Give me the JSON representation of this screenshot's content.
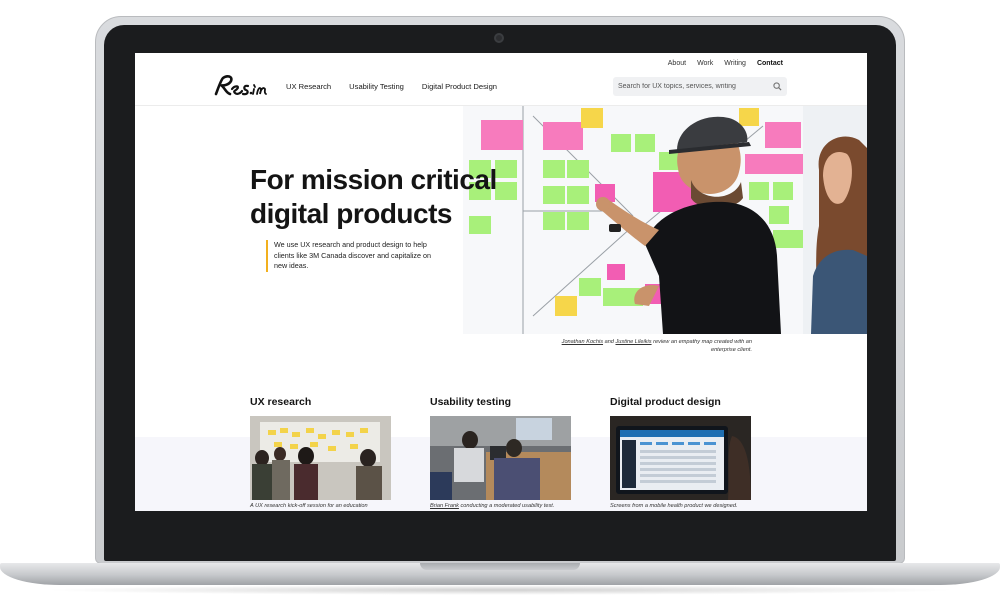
{
  "top_nav": [
    "About",
    "Work",
    "Writing",
    "Contact"
  ],
  "logo_text": "Res.im",
  "main_nav": [
    "UX Research",
    "Usability Testing",
    "Digital Product Design"
  ],
  "search": {
    "placeholder": "Search for UX topics, services, writing",
    "icon": "search-icon"
  },
  "hero": {
    "title_line1": "For mission critical",
    "title_line2": "digital products",
    "body": "We use UX research and product design to help clients like 3M Canada discover and capitalize on new ideas.",
    "accent_color": "#f2b01e",
    "caption": {
      "person1": "Jonathan Kochis",
      "joiner": "and",
      "person2": "Justine Lileikis",
      "rest": "review an empathy map created with an enterprise client."
    }
  },
  "services": [
    {
      "title": "UX research",
      "caption": "A UX research kick-off session for an education"
    },
    {
      "title": "Usability testing",
      "caption_name": "Brian Frank",
      "caption_rest": "conducting a moderated usability test."
    },
    {
      "title": "Digital product design",
      "caption": "Screens from a mobile health product we designed."
    }
  ]
}
